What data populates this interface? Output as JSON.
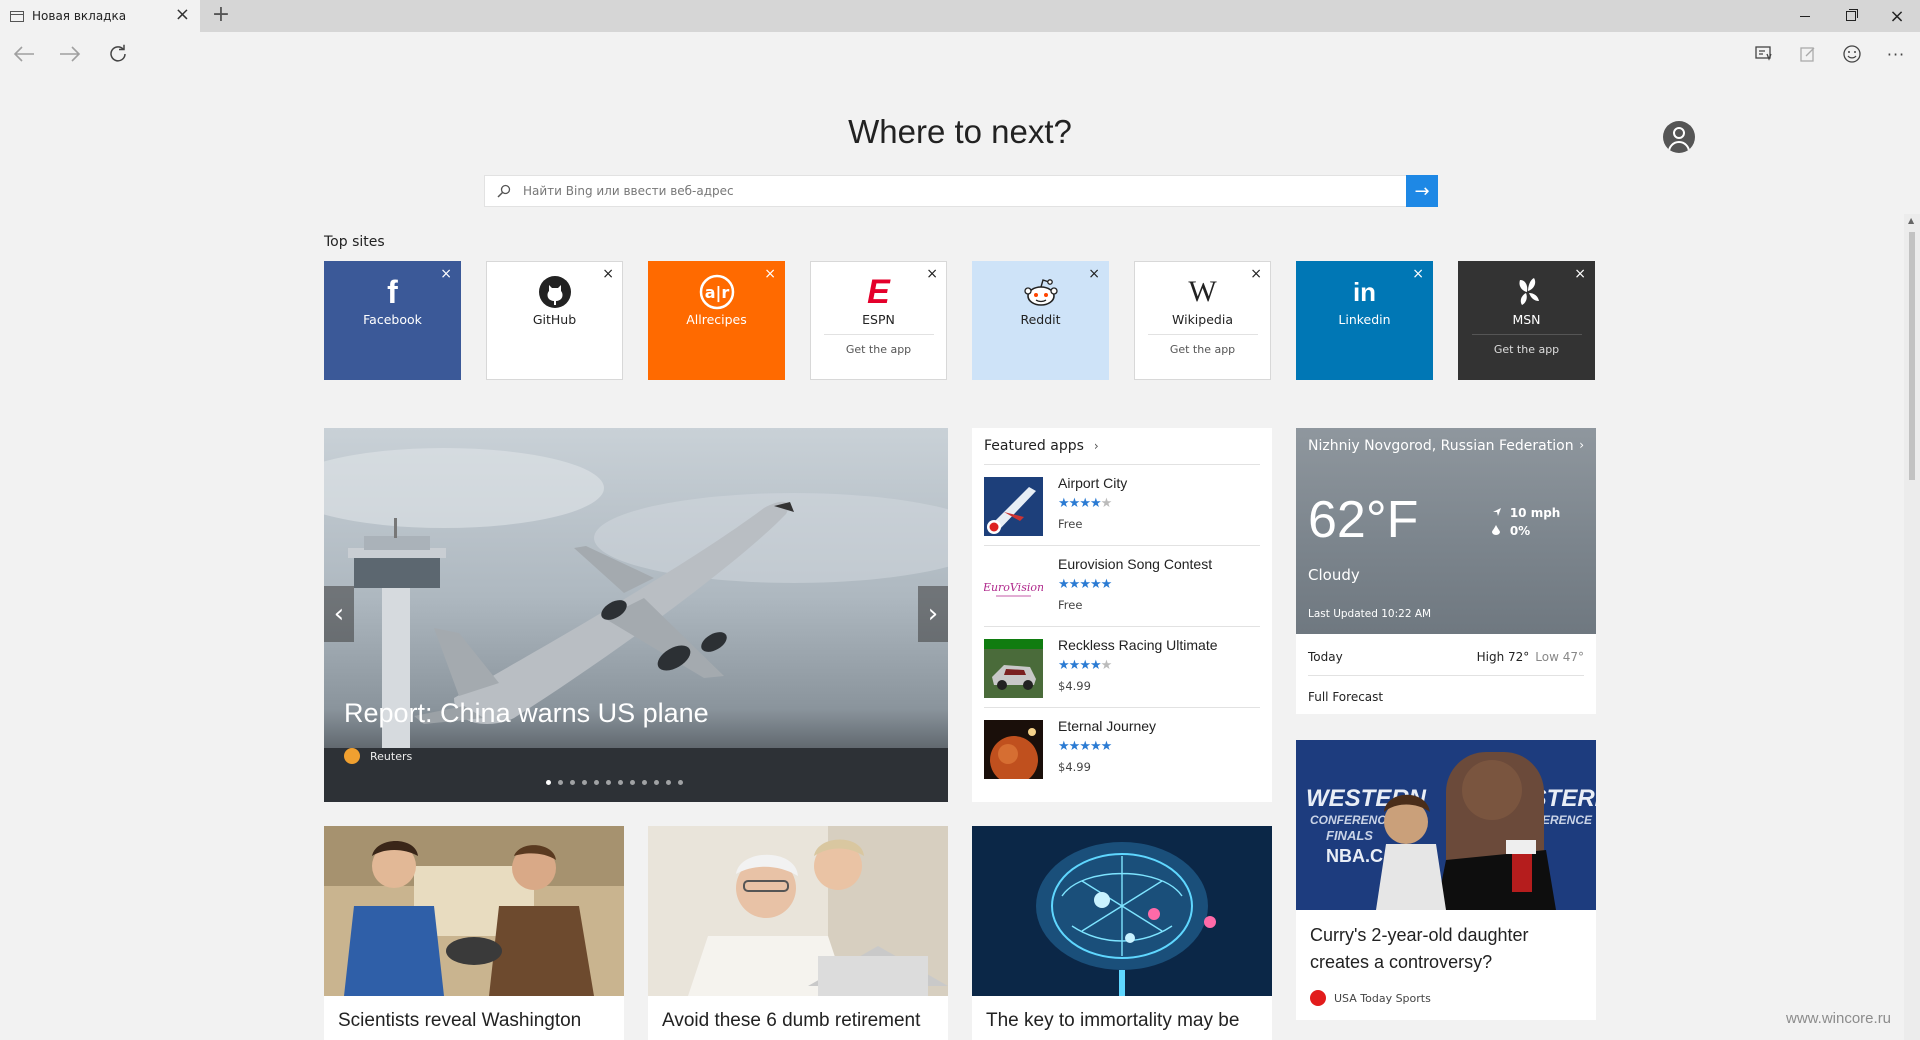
{
  "browser": {
    "tab_title": "Новая вкладка",
    "new_tab_symbol": "+",
    "close_symbol": "×"
  },
  "toolbar": {
    "back_icon": "back-arrow-icon",
    "forward_icon": "forward-arrow-icon",
    "refresh_icon": "refresh-icon",
    "reading_view_icon": "reading-list-icon",
    "note_icon": "web-note-icon",
    "feedback_icon": "smiley-icon",
    "more_label": "···"
  },
  "hero": {
    "heading": "Where to next?",
    "search_placeholder": "Найти Bing или ввести веб-адрес",
    "go_symbol": "→"
  },
  "top_sites": {
    "label": "Top sites",
    "tiles": [
      {
        "name": "Facebook",
        "logo": "f",
        "bg": "#3b5998",
        "fg": "#ffffff",
        "sub": ""
      },
      {
        "name": "GitHub",
        "logo": "",
        "bg": "#ffffff",
        "fg": "#222222",
        "sub": ""
      },
      {
        "name": "Allrecipes",
        "logo": "a|r",
        "bg": "#ff6a00",
        "fg": "#ffffff",
        "sub": ""
      },
      {
        "name": "ESPN",
        "logo": "E",
        "bg": "#ffffff",
        "fg": "#222222",
        "sub": "Get the app"
      },
      {
        "name": "Reddit",
        "logo": "",
        "bg": "#cee3f8",
        "fg": "#222222",
        "sub": ""
      },
      {
        "name": "Wikipedia",
        "logo": "W",
        "bg": "#ffffff",
        "fg": "#222222",
        "sub": "Get the app"
      },
      {
        "name": "Linkedin",
        "logo": "in",
        "bg": "#0077b5",
        "fg": "#ffffff",
        "sub": ""
      },
      {
        "name": "MSN",
        "logo": "",
        "bg": "#333333",
        "fg": "#ffffff",
        "sub": "Get the app"
      }
    ]
  },
  "headline": {
    "title": "Report: China warns US plane",
    "source": "Reuters",
    "prev_symbol": "‹",
    "next_symbol": "›"
  },
  "featured_apps": {
    "header": "Featured apps",
    "chevron": "›",
    "apps": [
      {
        "name": "Airport City",
        "rating": 4,
        "price": "Free"
      },
      {
        "name": "Eurovision Song Contest",
        "rating": 5,
        "price": "Free"
      },
      {
        "name": "Reckless Racing Ultimate",
        "rating": 4,
        "price": "$4.99"
      },
      {
        "name": "Eternal Journey",
        "rating": 4.5,
        "price": "$4.99"
      }
    ]
  },
  "weather": {
    "location": "Nizhniy Novgorod, Russian Federation",
    "chevron": "›",
    "temperature": "62°F",
    "condition": "Cloudy",
    "wind": "10 mph",
    "precip": "0%",
    "updated": "Last Updated 10:22 AM",
    "today_label": "Today",
    "high": "High 72°",
    "low": "Low 47°",
    "forecast_link": "Full Forecast"
  },
  "side_story": {
    "title": "Curry's 2-year-old daughter creates a controversy?",
    "source": "USA Today Sports",
    "img_text_1": "WESTERN",
    "img_text_2": "CONFERENCE",
    "img_text_3": "FINALS",
    "img_text_4": "NBA.C"
  },
  "stories": [
    {
      "title": "Scientists reveal Washington"
    },
    {
      "title": "Avoid these 6 dumb retirement"
    },
    {
      "title": "The key to immortality may be"
    }
  ],
  "watermark": "www.wincore.ru",
  "colors": {
    "accent": "#1e88e5",
    "star": "#2b7bd3"
  }
}
